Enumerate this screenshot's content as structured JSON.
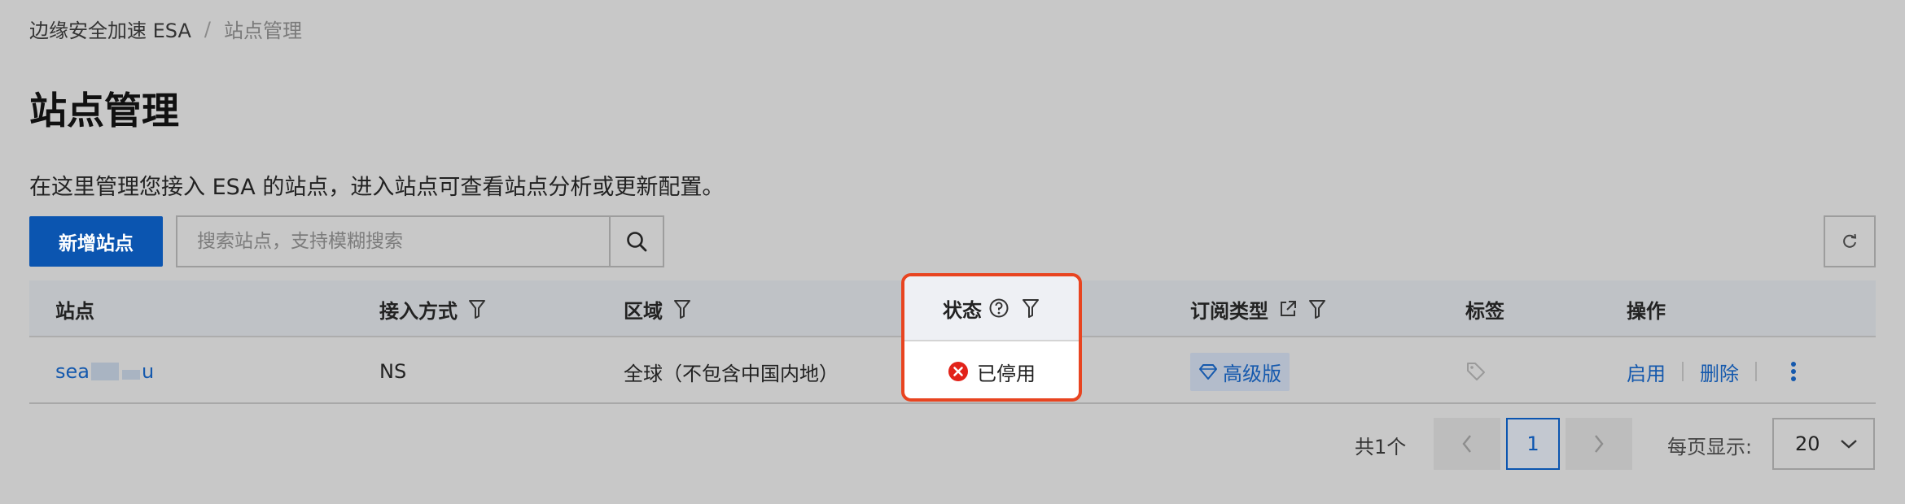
{
  "breadcrumb": {
    "parent": "边缘安全加速 ESA",
    "separator": "/",
    "current": "站点管理"
  },
  "page": {
    "title": "站点管理",
    "description": "在这里管理您接入 ESA 的站点，进入站点可查看站点分析或更新配置。"
  },
  "toolbar": {
    "add_label": "新增站点",
    "search_placeholder": "搜索站点，支持模糊搜索"
  },
  "table": {
    "headers": {
      "site": "站点",
      "access": "接入方式",
      "region": "区域",
      "status": "状态",
      "plan": "订阅类型",
      "tags": "标签",
      "actions": "操作"
    },
    "rows": [
      {
        "site_prefix": "sea",
        "site_suffix": "u",
        "access": "NS",
        "region": "全球（不包含中国内地）",
        "status": "已停用",
        "plan": "高级版",
        "action_enable": "启用",
        "action_delete": "删除"
      }
    ]
  },
  "pagination": {
    "total": "共1个",
    "current_page": "1",
    "per_page_label": "每页显示:",
    "per_page": "20"
  },
  "colors": {
    "primary": "#0b55b0",
    "link": "#1559ad",
    "highlight_border": "#e84420",
    "status_error": "#e2231a"
  }
}
